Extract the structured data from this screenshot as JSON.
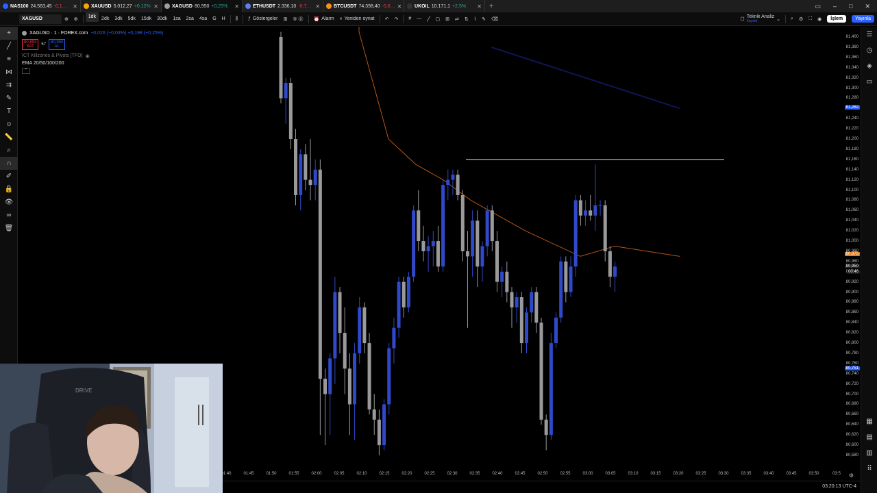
{
  "tabs": [
    {
      "symbol": "NAS100",
      "price": "24.563,45",
      "change": "-0,1…",
      "dir": "dn",
      "icon_color": "#2962ff"
    },
    {
      "symbol": "XAUUSD",
      "price": "5.012,27",
      "change": "+0,12%",
      "dir": "up",
      "icon_color": "#f7a600"
    },
    {
      "symbol": "XAGUSD",
      "price": "80,950",
      "change": "+0,25%",
      "dir": "up",
      "icon_color": "#9e9e9e",
      "active": true
    },
    {
      "symbol": "ETHUSDT",
      "price": "2.336,10",
      "change": "-0,7…",
      "dir": "dn",
      "icon_color": "#627eea"
    },
    {
      "symbol": "BTCUSDT",
      "price": "74.398,40",
      "change": "-0,6…",
      "dir": "dn",
      "icon_color": "#f7931a"
    },
    {
      "symbol": "UKOIL",
      "price": "10.171,1",
      "change": "+2,5%",
      "dir": "up",
      "icon_color": "#333333"
    }
  ],
  "toolbar": {
    "symbol": "XAGUSD",
    "intervals": [
      "1dk",
      "2dk",
      "3dk",
      "5dk",
      "15dk",
      "30dk",
      "1sa",
      "2sa",
      "4sa",
      "G",
      "H"
    ],
    "active_interval": "1dk",
    "indicators": "Göstergeler",
    "alarm": "Alarm",
    "replay": "Yeniden oynat",
    "tech_analysis": "Teknik Analiz",
    "tech_sub": "Kaydet",
    "trade": "İşlem",
    "publish": "Yayınla"
  },
  "legend": {
    "title": "XAGUSD · 1 · FOREX.com",
    "change": "−0,026 (−0,03%) +0,198 (+0,25%)",
    "sell_price": "80,893",
    "sell_label": "SAT",
    "spread": "57",
    "buy_price": "80,950",
    "buy_label": "AL",
    "indicator1": "ICT Killzones & Pivots [TFO]",
    "indicator2": "EMA 20/50/100/200"
  },
  "axis": {
    "y_labels": [
      "81,400",
      "81,380",
      "81,360",
      "81,340",
      "81,320",
      "81,300",
      "81,280",
      "81,260",
      "81,240",
      "81,220",
      "81,200",
      "81,180",
      "81,160",
      "81,140",
      "81,120",
      "81,100",
      "81,080",
      "81,060",
      "81,040",
      "81,020",
      "81,000",
      "80,980",
      "80,960",
      "80,940",
      "80,920",
      "80,900",
      "80,880",
      "80,860",
      "80,840",
      "80,820",
      "80,800",
      "80,780",
      "80,760",
      "80,740",
      "80,720",
      "80,700",
      "80,680",
      "80,660",
      "80,640",
      "80,620",
      "80,600",
      "80,580"
    ],
    "badges": [
      {
        "text": "81,262",
        "value": 81.262,
        "color": "#2962ff"
      },
      {
        "text": "80,975",
        "value": 80.975,
        "color": "#e67c1a"
      },
      {
        "text": "80,950",
        "value": 80.95,
        "color": "#1c1c1c"
      },
      {
        "text": "00:46",
        "value": 80.94,
        "color": "#1c1c1c"
      },
      {
        "text": "80,751",
        "value": 80.751,
        "color": "#2962ff"
      }
    ],
    "x_labels": [
      "01:40",
      "01:45",
      "01:50",
      "01:55",
      "02:00",
      "02:05",
      "02:10",
      "02:15",
      "02:20",
      "02:25",
      "02:30",
      "02:35",
      "02:40",
      "02:45",
      "02:50",
      "02:55",
      "03:00",
      "03:05",
      "03:10",
      "03:15",
      "03:20",
      "03:25",
      "03:30",
      "03:35",
      "03:40",
      "03:45",
      "03:50",
      "03:5"
    ]
  },
  "status": {
    "clock": "03:20:13 UTC-4"
  },
  "colors": {
    "bull": "#2f49c8",
    "bear": "#9a9a9a",
    "ema": "#b5561a",
    "ema_slow": "#16207a",
    "line": "#e0e0e0"
  },
  "chart_data": {
    "type": "candlestick",
    "x_start": "01:59",
    "interval_minutes": 1,
    "y_range": [
      80.58,
      81.41
    ],
    "candles": [
      [
        81.4,
        81.41,
        81.27,
        81.28
      ],
      [
        81.28,
        81.32,
        81.23,
        81.31
      ],
      [
        81.31,
        81.32,
        81.18,
        81.2
      ],
      [
        81.2,
        81.22,
        81.07,
        81.09
      ],
      [
        81.09,
        81.18,
        81.06,
        81.17
      ],
      [
        81.17,
        81.19,
        81.1,
        81.12
      ],
      [
        81.12,
        81.2,
        81.08,
        81.11
      ],
      [
        81.11,
        81.16,
        81.08,
        81.14
      ],
      [
        81.14,
        81.16,
        80.62,
        80.73
      ],
      [
        80.73,
        80.75,
        80.6,
        80.7
      ],
      [
        80.7,
        80.78,
        80.62,
        80.77
      ],
      [
        80.77,
        80.93,
        80.72,
        80.9
      ],
      [
        80.9,
        80.91,
        80.78,
        80.82
      ],
      [
        80.82,
        80.87,
        80.7,
        80.75
      ],
      [
        80.75,
        80.78,
        80.62,
        80.68
      ],
      [
        80.68,
        80.8,
        80.61,
        80.78
      ],
      [
        80.78,
        80.89,
        80.76,
        80.87
      ],
      [
        80.87,
        80.88,
        80.78,
        80.8
      ],
      [
        80.8,
        80.82,
        80.66,
        80.67
      ],
      [
        80.67,
        80.7,
        80.62,
        80.65
      ],
      [
        80.65,
        80.67,
        80.58,
        80.6
      ],
      [
        80.6,
        80.69,
        80.59,
        80.68
      ],
      [
        80.68,
        80.8,
        80.66,
        80.79
      ],
      [
        80.79,
        80.85,
        80.76,
        80.83
      ],
      [
        80.83,
        80.93,
        80.81,
        80.92
      ],
      [
        80.92,
        80.93,
        80.85,
        80.87
      ],
      [
        80.87,
        80.94,
        80.86,
        80.93
      ],
      [
        80.93,
        81.07,
        80.92,
        81.06
      ],
      [
        81.06,
        81.1,
        80.98,
        81.0
      ],
      [
        81.0,
        81.03,
        80.96,
        80.98
      ],
      [
        80.98,
        81.01,
        80.94,
        80.99
      ],
      [
        80.99,
        81.02,
        80.95,
        81.0
      ],
      [
        81.0,
        81.03,
        80.94,
        80.95
      ],
      [
        80.95,
        81.12,
        80.94,
        81.11
      ],
      [
        81.11,
        81.14,
        81.08,
        81.12
      ],
      [
        81.12,
        81.14,
        81.09,
        81.13
      ],
      [
        81.13,
        81.14,
        81.08,
        81.09
      ],
      [
        81.09,
        81.1,
        80.96,
        80.98
      ],
      [
        80.98,
        81.02,
        80.83,
        80.97
      ],
      [
        80.97,
        81.06,
        80.93,
        81.04
      ],
      [
        81.04,
        81.06,
        80.91,
        80.95
      ],
      [
        80.95,
        81.0,
        80.92,
        80.99
      ],
      [
        80.99,
        81.07,
        80.97,
        81.06
      ],
      [
        81.06,
        81.07,
        80.98,
        81.0
      ],
      [
        81.0,
        81.02,
        80.9,
        80.92
      ],
      [
        80.92,
        80.95,
        80.89,
        80.94
      ],
      [
        80.94,
        80.96,
        80.88,
        80.9
      ],
      [
        80.9,
        80.91,
        80.83,
        80.87
      ],
      [
        80.87,
        80.9,
        80.84,
        80.89
      ],
      [
        80.89,
        80.9,
        80.78,
        80.8
      ],
      [
        80.8,
        80.87,
        80.78,
        80.86
      ],
      [
        80.86,
        80.91,
        80.84,
        80.9
      ],
      [
        80.9,
        80.91,
        80.82,
        80.84
      ],
      [
        80.84,
        80.85,
        80.64,
        80.65
      ],
      [
        80.65,
        80.66,
        80.59,
        80.62
      ],
      [
        80.62,
        80.82,
        80.61,
        80.8
      ],
      [
        80.8,
        80.86,
        80.79,
        80.85
      ],
      [
        80.85,
        80.97,
        80.84,
        80.96
      ],
      [
        80.96,
        80.97,
        80.88,
        80.9
      ],
      [
        80.9,
        80.97,
        80.89,
        80.95
      ],
      [
        80.95,
        81.09,
        80.93,
        81.08
      ],
      [
        81.08,
        81.09,
        81.03,
        81.05
      ],
      [
        81.05,
        81.08,
        81.03,
        81.06
      ],
      [
        81.06,
        81.09,
        81.04,
        81.05
      ],
      [
        81.05,
        81.15,
        81.02,
        81.07
      ],
      [
        81.07,
        81.08,
        81.05,
        81.07
      ],
      [
        81.07,
        81.08,
        80.96,
        80.98
      ],
      [
        80.98,
        80.99,
        80.91,
        80.93
      ],
      [
        80.93,
        80.96,
        80.9,
        80.95
      ]
    ],
    "resistance_level": 81.16,
    "ema_fast": [
      [
        81.45,
        81.41
      ],
      [
        81.3,
        81.2
      ],
      [
        81.18,
        81.15
      ],
      [
        81.15,
        81.12
      ],
      [
        81.12,
        81.08
      ],
      [
        81.08,
        81.02
      ],
      [
        81.02,
        80.97
      ],
      [
        80.97,
        80.99
      ],
      [
        80.99,
        80.97
      ]
    ],
    "ema_slow_segment": [
      81.38,
      81.26
    ]
  }
}
